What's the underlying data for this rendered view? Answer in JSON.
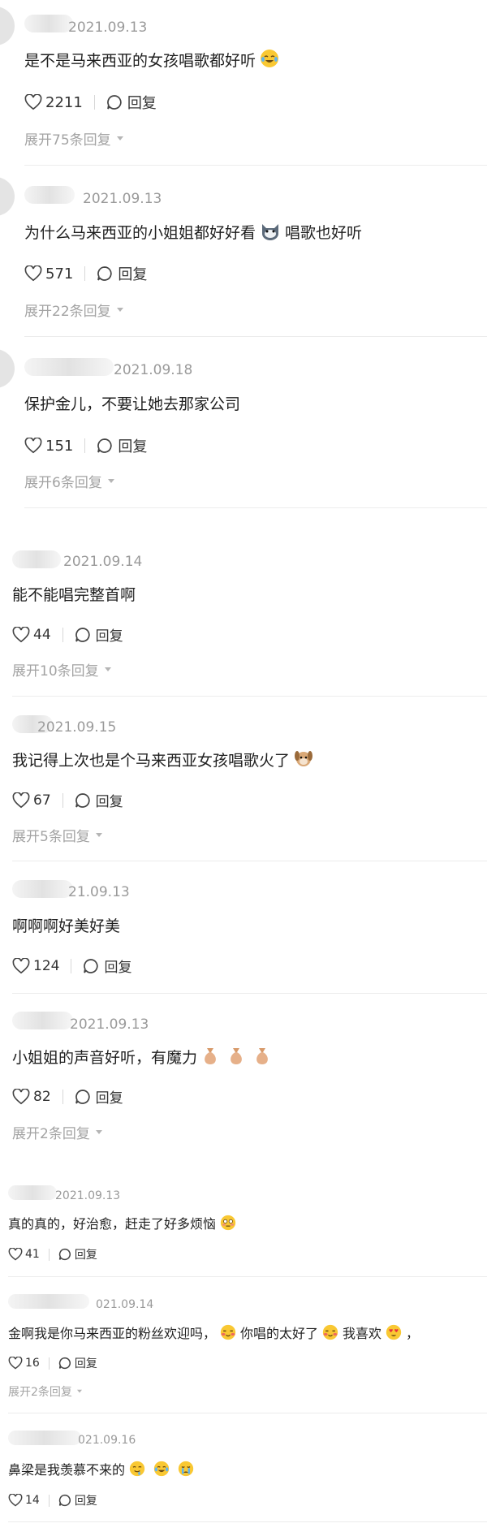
{
  "comments": [
    {
      "date": "2021.09.13",
      "text": "是不是马来西亚的女孩唱歌都好听",
      "emojis": [
        "laugh-cry"
      ],
      "likes": "2211",
      "reply": "回复",
      "expand": "展开75条回复"
    },
    {
      "date": "2021.09.13",
      "text": "为什么马来西亚的小姐姐都好好看",
      "text2": "唱歌也好听",
      "emojis": [
        "cat"
      ],
      "likes": "571",
      "reply": "回复",
      "expand": "展开22条回复"
    },
    {
      "date": "2021.09.18",
      "text": "保护金儿，不要让她去那家公司",
      "emojis": [],
      "likes": "151",
      "reply": "回复",
      "expand": "展开6条回复"
    },
    {
      "date": "2021.09.14",
      "text": "能不能唱完整首啊",
      "emojis": [],
      "likes": "44",
      "reply": "回复",
      "expand": "展开10条回复"
    },
    {
      "date": "2021.09.15",
      "text": "我记得上次也是个马来西亚女孩唱歌火了",
      "emojis": [
        "dog"
      ],
      "likes": "67",
      "reply": "回复",
      "expand": "展开5条回复"
    },
    {
      "date": "21.09.13",
      "text": "啊啊啊好美好美",
      "emojis": [],
      "likes": "124",
      "reply": "回复",
      "expand": ""
    },
    {
      "date": "2021.09.13",
      "text": "小姐姐的声音好听，有魔力",
      "emojis": [
        "money-bag",
        "money-bag",
        "money-bag"
      ],
      "likes": "82",
      "reply": "回复",
      "expand": "展开2条回复"
    },
    {
      "date": "2021.09.13",
      "text": "真的真的，好治愈，赶走了好多烦恼",
      "emojis": [
        "flushed"
      ],
      "likes": "41",
      "reply": "回复",
      "expand": ""
    },
    {
      "date": "021.09.14",
      "text": "金啊我是你马来西亚的粉丝欢迎吗，",
      "text2": "你唱的太好了",
      "text3": "我喜欢",
      "text4": "，",
      "emojis": [
        "blush",
        "blush",
        "heart-eyes"
      ],
      "likes": "16",
      "reply": "回复",
      "expand": "展开2条回复"
    },
    {
      "date": "021.09.16",
      "text": "鼻梁是我羡慕不来的",
      "emojis": [
        "drool",
        "laugh-cry",
        "crying"
      ],
      "likes": "14",
      "reply": "回复",
      "expand": ""
    }
  ],
  "colors": {
    "text": "#1f1f1f",
    "meta": "#9a9a9a",
    "divider": "#ececec"
  }
}
